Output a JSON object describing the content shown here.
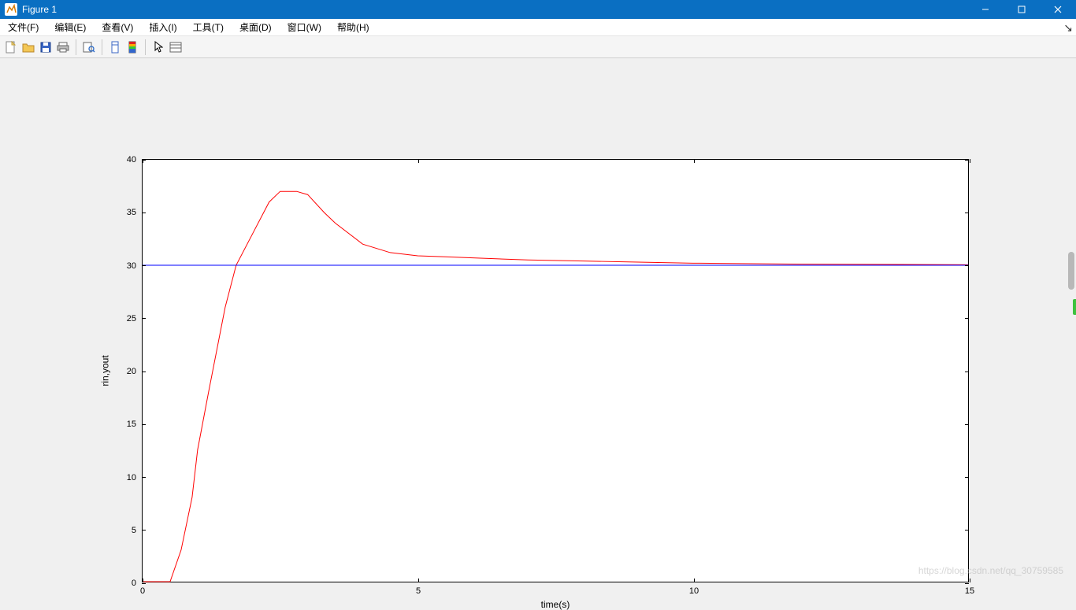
{
  "window": {
    "title": "Figure 1"
  },
  "menu": {
    "file": "文件(F)",
    "edit": "编辑(E)",
    "view": "查看(V)",
    "insert": "插入(I)",
    "tools": "工具(T)",
    "desktop": "桌面(D)",
    "window": "窗口(W)",
    "help": "帮助(H)"
  },
  "toolbar": {
    "new": "new-file-icon",
    "open": "open-folder-icon",
    "save": "save-icon",
    "print": "print-icon",
    "printpreview": "print-preview-icon",
    "link": "link-icon",
    "colorbar": "colorbar-icon",
    "legend": "legend-icon",
    "pointer": "pointer-icon",
    "datacursor": "data-cursor-icon"
  },
  "axes": {
    "xlabel": "time(s)",
    "ylabel": "rin,yout",
    "xlim": [
      0,
      15
    ],
    "ylim": [
      0,
      40
    ],
    "xticks": [
      0,
      5,
      10,
      15
    ],
    "yticks": [
      0,
      5,
      10,
      15,
      20,
      25,
      30,
      35,
      40
    ]
  },
  "colors": {
    "series_rin": "#0000ff",
    "series_yout": "#ff0000"
  },
  "watermark": "https://blog.csdn.net/qq_30759585",
  "chart_data": {
    "type": "line",
    "title": "",
    "xlabel": "time(s)",
    "ylabel": "rin,yout",
    "xlim": [
      0,
      15
    ],
    "ylim": [
      0,
      40
    ],
    "x": [
      0,
      0.5,
      0.7,
      0.9,
      1.0,
      1.2,
      1.5,
      1.7,
      2.0,
      2.3,
      2.5,
      2.8,
      3.0,
      3.3,
      3.5,
      4.0,
      4.5,
      5.0,
      5.5,
      6.0,
      7.0,
      8.0,
      9.0,
      10.0,
      12.0,
      15.0
    ],
    "series": [
      {
        "name": "yout",
        "color": "#ff0000",
        "values": [
          0,
          0,
          3,
          8,
          12.5,
          18,
          26,
          30,
          33,
          36,
          37,
          37,
          36.7,
          35,
          34,
          32,
          31.2,
          30.9,
          30.8,
          30.7,
          30.5,
          30.4,
          30.3,
          30.2,
          30.1,
          30.05
        ]
      },
      {
        "name": "rin",
        "color": "#0000ff",
        "values": [
          30,
          30,
          30,
          30,
          30,
          30,
          30,
          30,
          30,
          30,
          30,
          30,
          30,
          30,
          30,
          30,
          30,
          30,
          30,
          30,
          30,
          30,
          30,
          30,
          30,
          30
        ]
      }
    ]
  }
}
